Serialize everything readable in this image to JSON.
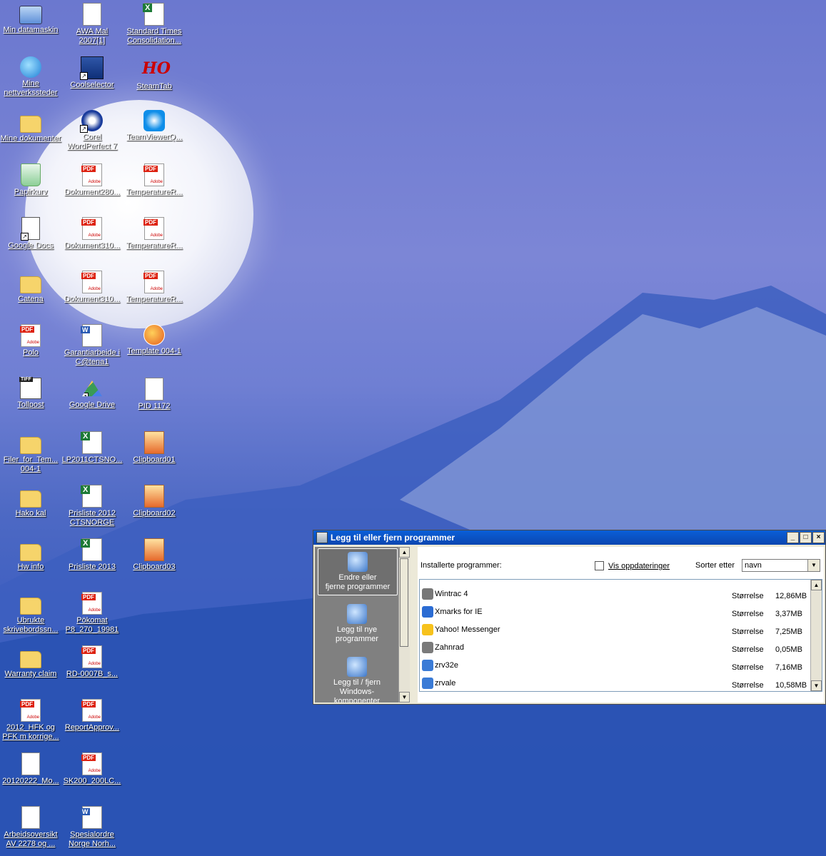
{
  "desktop_icons": [
    {
      "label": "Min datamaskin",
      "type": "pc"
    },
    {
      "label": "AWA Mal\n2007[1]",
      "type": "txt"
    },
    {
      "label": "Standard Times\nConsolidation...",
      "type": "xls"
    },
    {
      "label": "Mine\nnettverkssteder",
      "type": "globe"
    },
    {
      "label": "Coolselector",
      "type": "app"
    },
    {
      "label": "SteamTab",
      "type": "ho"
    },
    {
      "label": "Mine dokumenter",
      "type": "folder"
    },
    {
      "label": "Corel\nWordPerfect 7",
      "type": "corel"
    },
    {
      "label": "TeamViewerQ...",
      "type": "tv"
    },
    {
      "label": "Papirkurv",
      "type": "recycle"
    },
    {
      "label": "Dokument280...",
      "type": "pdf"
    },
    {
      "label": "TemperatureR...",
      "type": "pdf"
    },
    {
      "label": "Google Docs",
      "type": "gdocs"
    },
    {
      "label": "Dokument310...",
      "type": "pdf"
    },
    {
      "label": "TemperatureR...",
      "type": "pdf"
    },
    {
      "label": "Catena",
      "type": "folder"
    },
    {
      "label": "Dokument310...",
      "type": "pdf"
    },
    {
      "label": "TemperatureR...",
      "type": "pdf"
    },
    {
      "label": "Polo",
      "type": "pdf"
    },
    {
      "label": "Garantiarbeide i\nC@tena1",
      "type": "doc"
    },
    {
      "label": "Template 004-1",
      "type": "firefox"
    },
    {
      "label": "Tollpost",
      "type": "tiff"
    },
    {
      "label": "Google Drive",
      "type": "drive"
    },
    {
      "label": "PID 1172",
      "type": "txt"
    },
    {
      "label": "Filer_for_Tem...\n004-1",
      "type": "folder"
    },
    {
      "label": "LP2011CTSNO...",
      "type": "xls"
    },
    {
      "label": "Clipboard01",
      "type": "img"
    },
    {
      "label": "Hako kal",
      "type": "folder"
    },
    {
      "label": "Prisliste 2012\nCTSNORGE",
      "type": "xls"
    },
    {
      "label": "Clipboard02",
      "type": "img"
    },
    {
      "label": "Hw info",
      "type": "folder"
    },
    {
      "label": "Prisliste 2013",
      "type": "xls"
    },
    {
      "label": "Clipboard03",
      "type": "img"
    },
    {
      "label": "Ubrukte\nskrivebordssn...",
      "type": "folder"
    },
    {
      "label": "Pökomat\nP8_270_19981",
      "type": "pdf"
    },
    {
      "label": "Warranty claim",
      "type": "folder"
    },
    {
      "label": "RD-0007B_s...",
      "type": "pdf"
    },
    {
      "label": "2012_HFK og\nPFK m korrige...",
      "type": "pdf"
    },
    {
      "label": "ReportApprov...",
      "type": "pdf"
    },
    {
      "label": "20120222_Mo...",
      "type": "txt"
    },
    {
      "label": "SK200_200LC...",
      "type": "pdf"
    },
    {
      "label": "Arbeidsoversikt\nAV 2278 og ...",
      "type": "txt"
    },
    {
      "label": "Spesialordre\nNorge Norh...",
      "type": "doc"
    }
  ],
  "window": {
    "title": "Legg til eller fjern programmer",
    "minimize": "_",
    "maximize": "□",
    "close": "×",
    "nav": [
      {
        "label": "Endre eller\nfjerne programmer",
        "icon": "change-remove-icon",
        "active": true
      },
      {
        "label": "Legg til nye\nprogrammer",
        "icon": "add-programs-icon",
        "active": false
      },
      {
        "label": "Legg til / fjern\nWindows-\nkomponenter",
        "icon": "windows-components-icon",
        "active": false
      }
    ],
    "installed_label": "Installerte programmer:",
    "show_updates_label": "Vis oppdateringer",
    "sort_label": "Sorter etter",
    "sort_value": "navn",
    "size_label": "Størrelse",
    "programs": [
      {
        "name": "Wintrac 4",
        "size": "12,86MB"
      },
      {
        "name": "Xmarks for IE",
        "size": "3,37MB"
      },
      {
        "name": "Yahoo! Messenger",
        "size": "7,25MB"
      },
      {
        "name": "Zahnrad",
        "size": "0,05MB"
      },
      {
        "name": "zrv32e",
        "size": "7,16MB"
      },
      {
        "name": "zrvale",
        "size": "10,58MB"
      }
    ]
  }
}
